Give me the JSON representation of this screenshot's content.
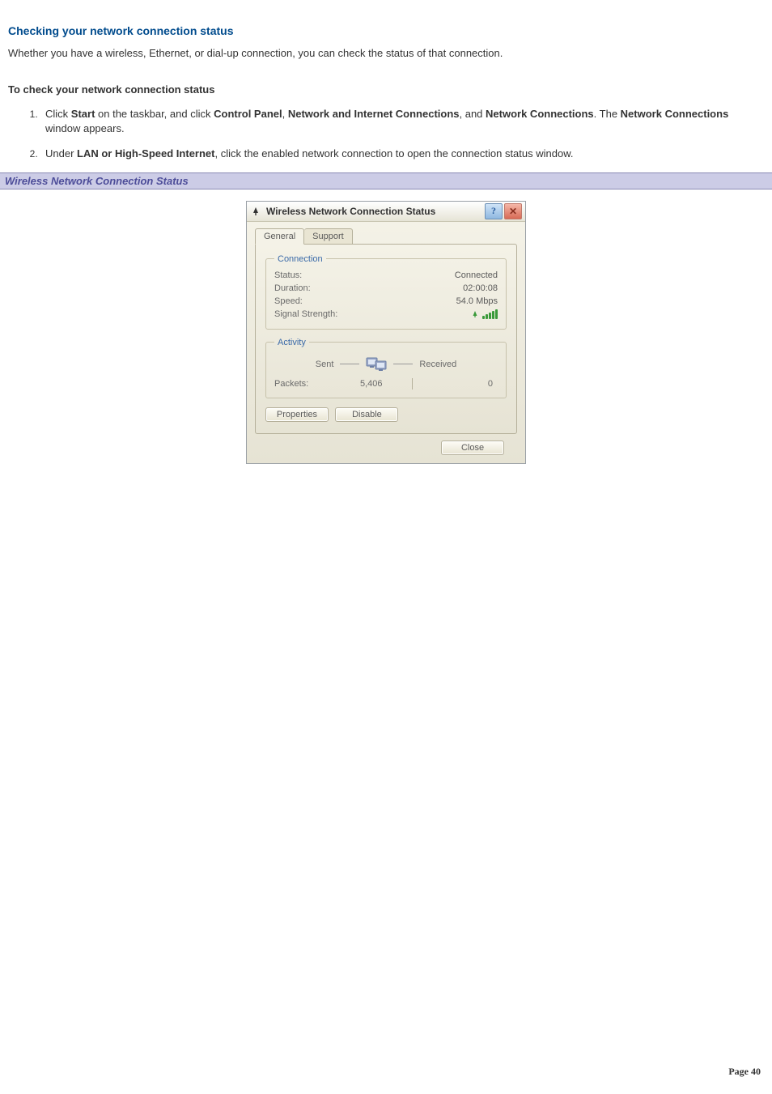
{
  "doc": {
    "heading": "Checking your network connection status",
    "intro": "Whether you have a wireless, Ethernet, or dial-up connection, you can check the status of that connection.",
    "subhead": "To check your network connection status",
    "step1_a": "Click ",
    "step1_b": "Start",
    "step1_c": " on the taskbar, and click ",
    "step1_d": "Control Panel",
    "step1_e": ", ",
    "step1_f": "Network and Internet Connections",
    "step1_g": ", and ",
    "step1_h": "Network Connections",
    "step1_i": ". The ",
    "step1_j": "Network Connections",
    "step1_k": " window appears.",
    "step2_a": "Under ",
    "step2_b": "LAN or High-Speed Internet",
    "step2_c": ", click the enabled network connection to open the connection status window.",
    "caption": "Wireless Network Connection Status"
  },
  "dialog": {
    "title": "Wireless Network Connection Status",
    "tabs": {
      "general": "General",
      "support": "Support"
    },
    "group_connection": "Connection",
    "group_activity": "Activity",
    "labels": {
      "status": "Status:",
      "duration": "Duration:",
      "speed": "Speed:",
      "signal": "Signal Strength:",
      "sent": "Sent",
      "received": "Received",
      "packets": "Packets:"
    },
    "values": {
      "status": "Connected",
      "duration": "02:00:08",
      "speed": "54.0 Mbps",
      "packets_sent": "5,406",
      "packets_received": "0"
    },
    "buttons": {
      "properties": "Properties",
      "disable": "Disable",
      "close": "Close"
    }
  },
  "pagenum": {
    "label": "Page ",
    "value": "40"
  }
}
